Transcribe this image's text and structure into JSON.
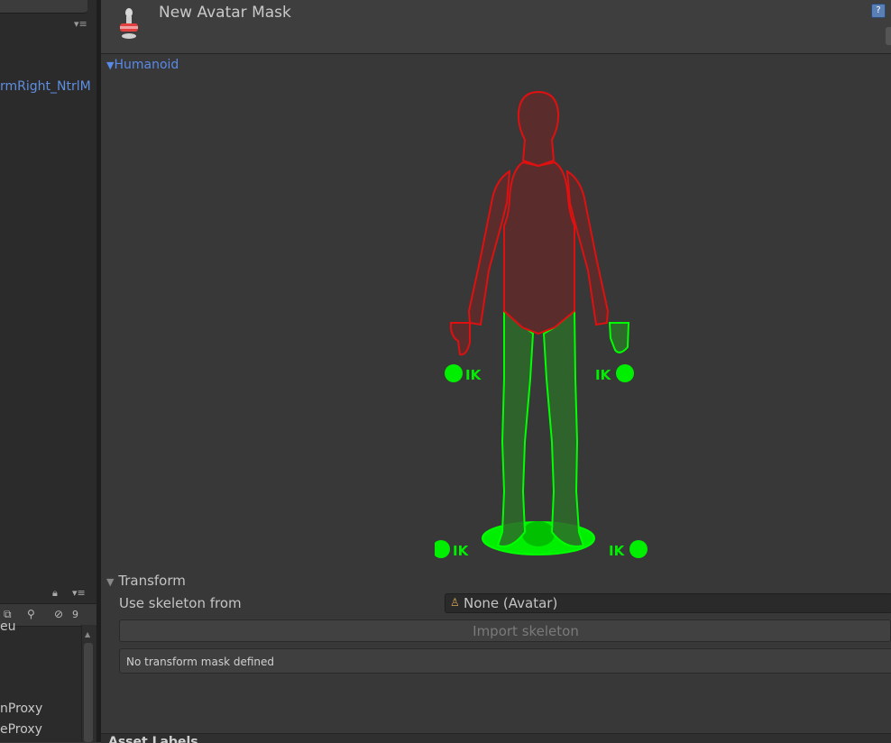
{
  "left_panel": {
    "bone_item": "rmRight_NtrlM",
    "hidden_count": "9",
    "list_rows": [
      "eu",
      "nProxy",
      "eProxy"
    ]
  },
  "inspector": {
    "asset_title": "New Avatar Mask",
    "humanoid_foldout": "Humanoid",
    "ik_label": "IK",
    "transform_foldout": "Transform",
    "skeleton_label": "Use skeleton from",
    "skeleton_value": "None (Avatar)",
    "import_button": "Import skeleton",
    "helpbox": "No transform mask defined",
    "asset_labels": "Asset Labels"
  },
  "colors": {
    "enabled_part": "#00ff00",
    "disabled_part": "#e01010",
    "link": "#5a8ae8"
  }
}
